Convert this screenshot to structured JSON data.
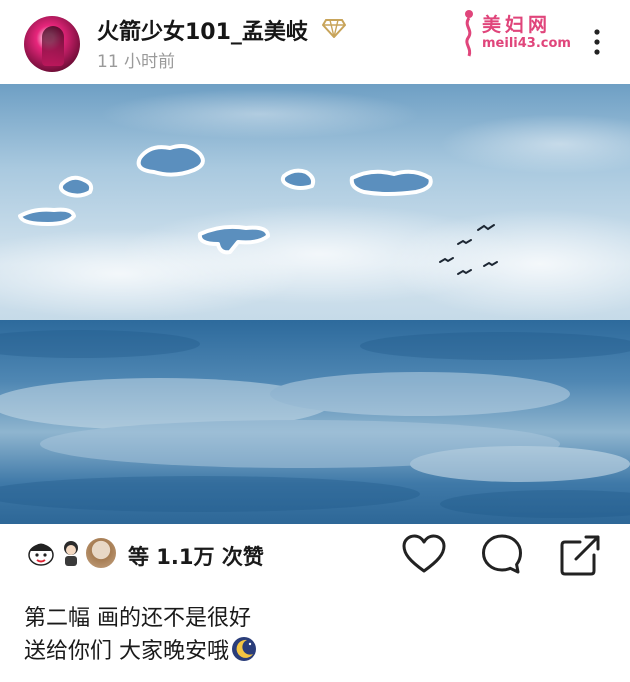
{
  "post": {
    "username": "火箭少女101_孟美岐",
    "timestamp": "11 小时前",
    "badge_icon": "diamond-verified-icon",
    "watermark": {
      "title": "美妇网",
      "url": "meili43.com"
    }
  },
  "actions": {
    "like_count": "等 1.1万 次赞",
    "icons": [
      "heart-icon",
      "comment-icon",
      "share-icon"
    ]
  },
  "caption": {
    "line1": "第二幅 画的还不是很好",
    "line2": "送给你们  大家晚安哦"
  },
  "colors": {
    "accent_watermark": "#e0457b",
    "badge_gold": "#c8a45a",
    "sky": "#9fc3dc",
    "sea": "#2f6ea0"
  }
}
